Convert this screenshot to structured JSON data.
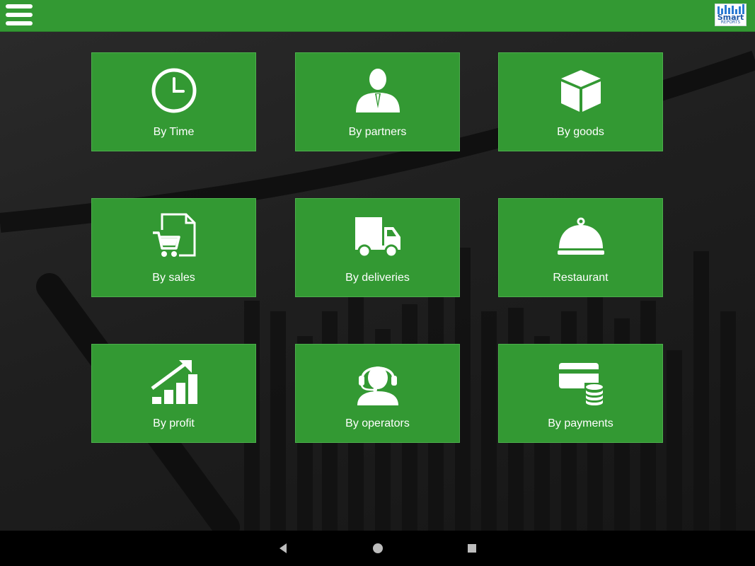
{
  "header": {
    "menu_icon": "hamburger-menu-icon",
    "logo": {
      "word": "Smart",
      "sub": "REPORTS",
      "color": "#1e5aa8"
    },
    "color": "#339933"
  },
  "tiles": [
    {
      "label": "By Time",
      "icon": "clock-icon"
    },
    {
      "label": "By partners",
      "icon": "businessman-icon"
    },
    {
      "label": "By goods",
      "icon": "box-icon"
    },
    {
      "label": "By sales",
      "icon": "cart-document-icon"
    },
    {
      "label": "By deliveries",
      "icon": "truck-icon"
    },
    {
      "label": "Restaurant",
      "icon": "cloche-icon"
    },
    {
      "label": "By profit",
      "icon": "growth-chart-icon"
    },
    {
      "label": "By operators",
      "icon": "headset-operator-icon"
    },
    {
      "label": "By payments",
      "icon": "card-coins-icon"
    }
  ],
  "navbar": {
    "back": "back-icon",
    "home": "home-icon",
    "recents": "recents-icon"
  }
}
